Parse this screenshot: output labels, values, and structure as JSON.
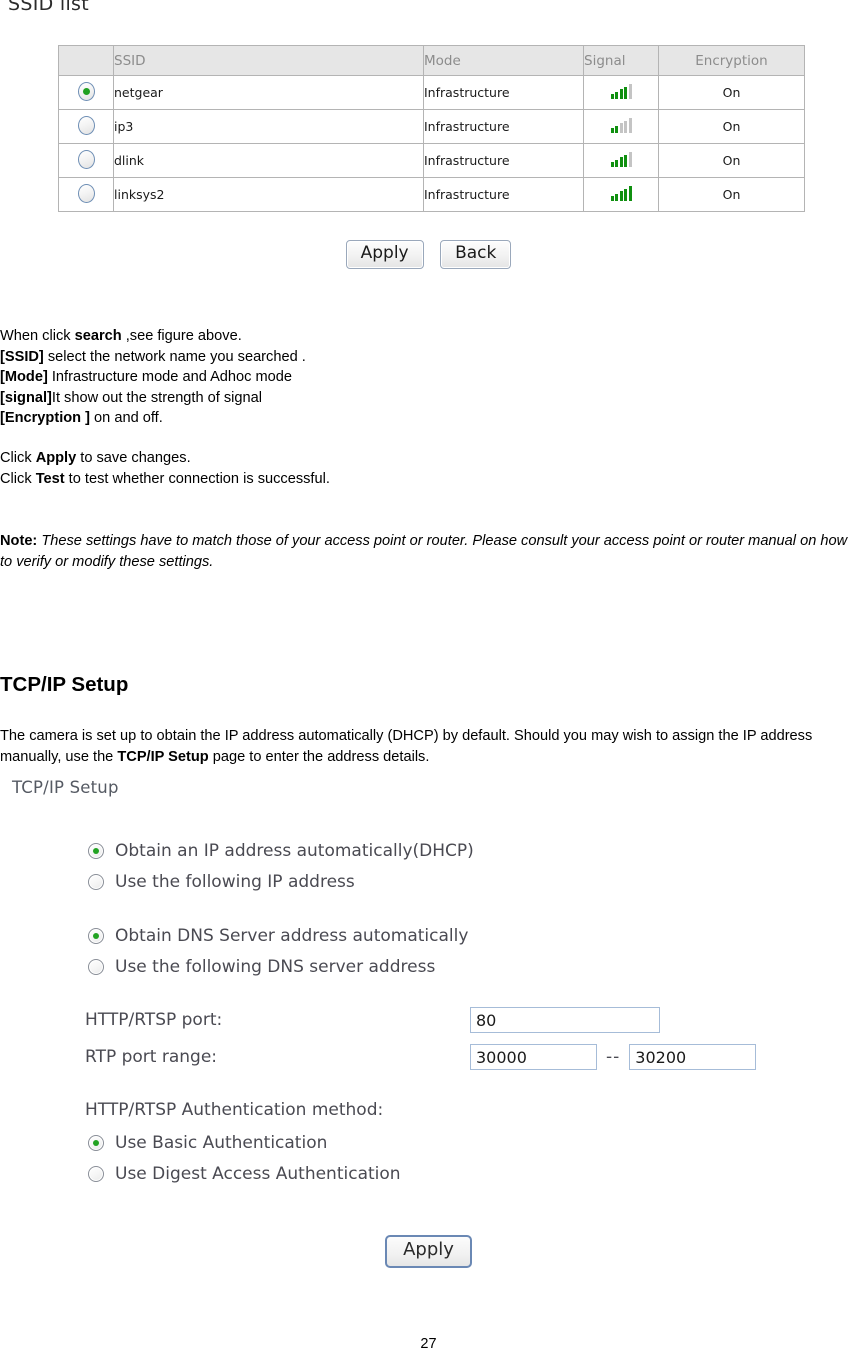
{
  "page": {
    "heading": "SSID list",
    "page_number": "27"
  },
  "ssid_table": {
    "headers": [
      "",
      "SSID",
      "Mode",
      "Signal",
      "Encryption"
    ],
    "rows": [
      {
        "selected": true,
        "ssid": "netgear",
        "mode": "Infrastructure",
        "signal_bars": 4,
        "signal_total": 5,
        "encryption": "On"
      },
      {
        "selected": false,
        "ssid": "ip3",
        "mode": "Infrastructure",
        "signal_bars": 2,
        "signal_total": 5,
        "encryption": "On"
      },
      {
        "selected": false,
        "ssid": "dlink",
        "mode": "Infrastructure",
        "signal_bars": 4,
        "signal_total": 5,
        "encryption": "On"
      },
      {
        "selected": false,
        "ssid": "linksys2",
        "mode": "Infrastructure",
        "signal_bars": 5,
        "signal_total": 5,
        "encryption": "On"
      }
    ]
  },
  "ssid_buttons": {
    "apply": "Apply",
    "back": "Back"
  },
  "explain": {
    "line1_pre": "When click ",
    "line1_bold": "search",
    "line1_post": " ,see figure above.",
    "line2_bold": "[SSID]",
    "line2_post": " select the network name you searched .",
    "line3_bold": "[Mode]",
    "line3_post": " Infrastructure mode and Adhoc mode",
    "line4_bold": "[signal]",
    "line4_post": "It show out the strength of signal",
    "line5_bold": "[Encryption ]",
    "line5_post": " on and off."
  },
  "clicks": {
    "line1_pre": "Click ",
    "line1_bold": "Apply",
    "line1_post": " to save changes.",
    "line2_pre": "Click ",
    "line2_bold": "Test",
    "line2_post": " to test whether connection is successful."
  },
  "note": {
    "label": "Note:",
    "text": " These settings have to match those of your access point or router. Please consult your access point or router manual on how to verify or modify these settings."
  },
  "tcpip_section": {
    "title": "TCP/IP Setup",
    "para_pre": "The camera is set up to obtain the IP address automatically (DHCP) by default. Should you may wish to assign the IP address manually, use the ",
    "para_bold": "TCP/IP Setup",
    "para_post": " page to enter the address details."
  },
  "tcpip_panel": {
    "title": "TCP/IP Setup",
    "ip_options": [
      {
        "label": "Obtain an IP address automatically(DHCP)",
        "selected": true
      },
      {
        "label": "Use the following IP address",
        "selected": false
      }
    ],
    "dns_options": [
      {
        "label": "Obtain DNS Server address automatically",
        "selected": true
      },
      {
        "label": "Use the following DNS server address",
        "selected": false
      }
    ],
    "http_port": {
      "label": "HTTP/RTSP port:",
      "value": "80"
    },
    "rtp_port_range": {
      "label": "RTP port range:",
      "from": "30000",
      "separator": "--",
      "to": "30200"
    },
    "auth_heading": "HTTP/RTSP Authentication method:",
    "auth_options": [
      {
        "label": "Use Basic Authentication",
        "selected": true
      },
      {
        "label": "Use Digest Access Authentication",
        "selected": false
      }
    ],
    "apply_label": "Apply"
  },
  "colors": {
    "signal_on": "#109010",
    "signal_off": "#c4c4c4",
    "radio_dot": "#22a322",
    "input_border": "#a6bcd8",
    "table_header_bg": "#e6e6e6",
    "apply_button_border": "#6a88b4"
  }
}
